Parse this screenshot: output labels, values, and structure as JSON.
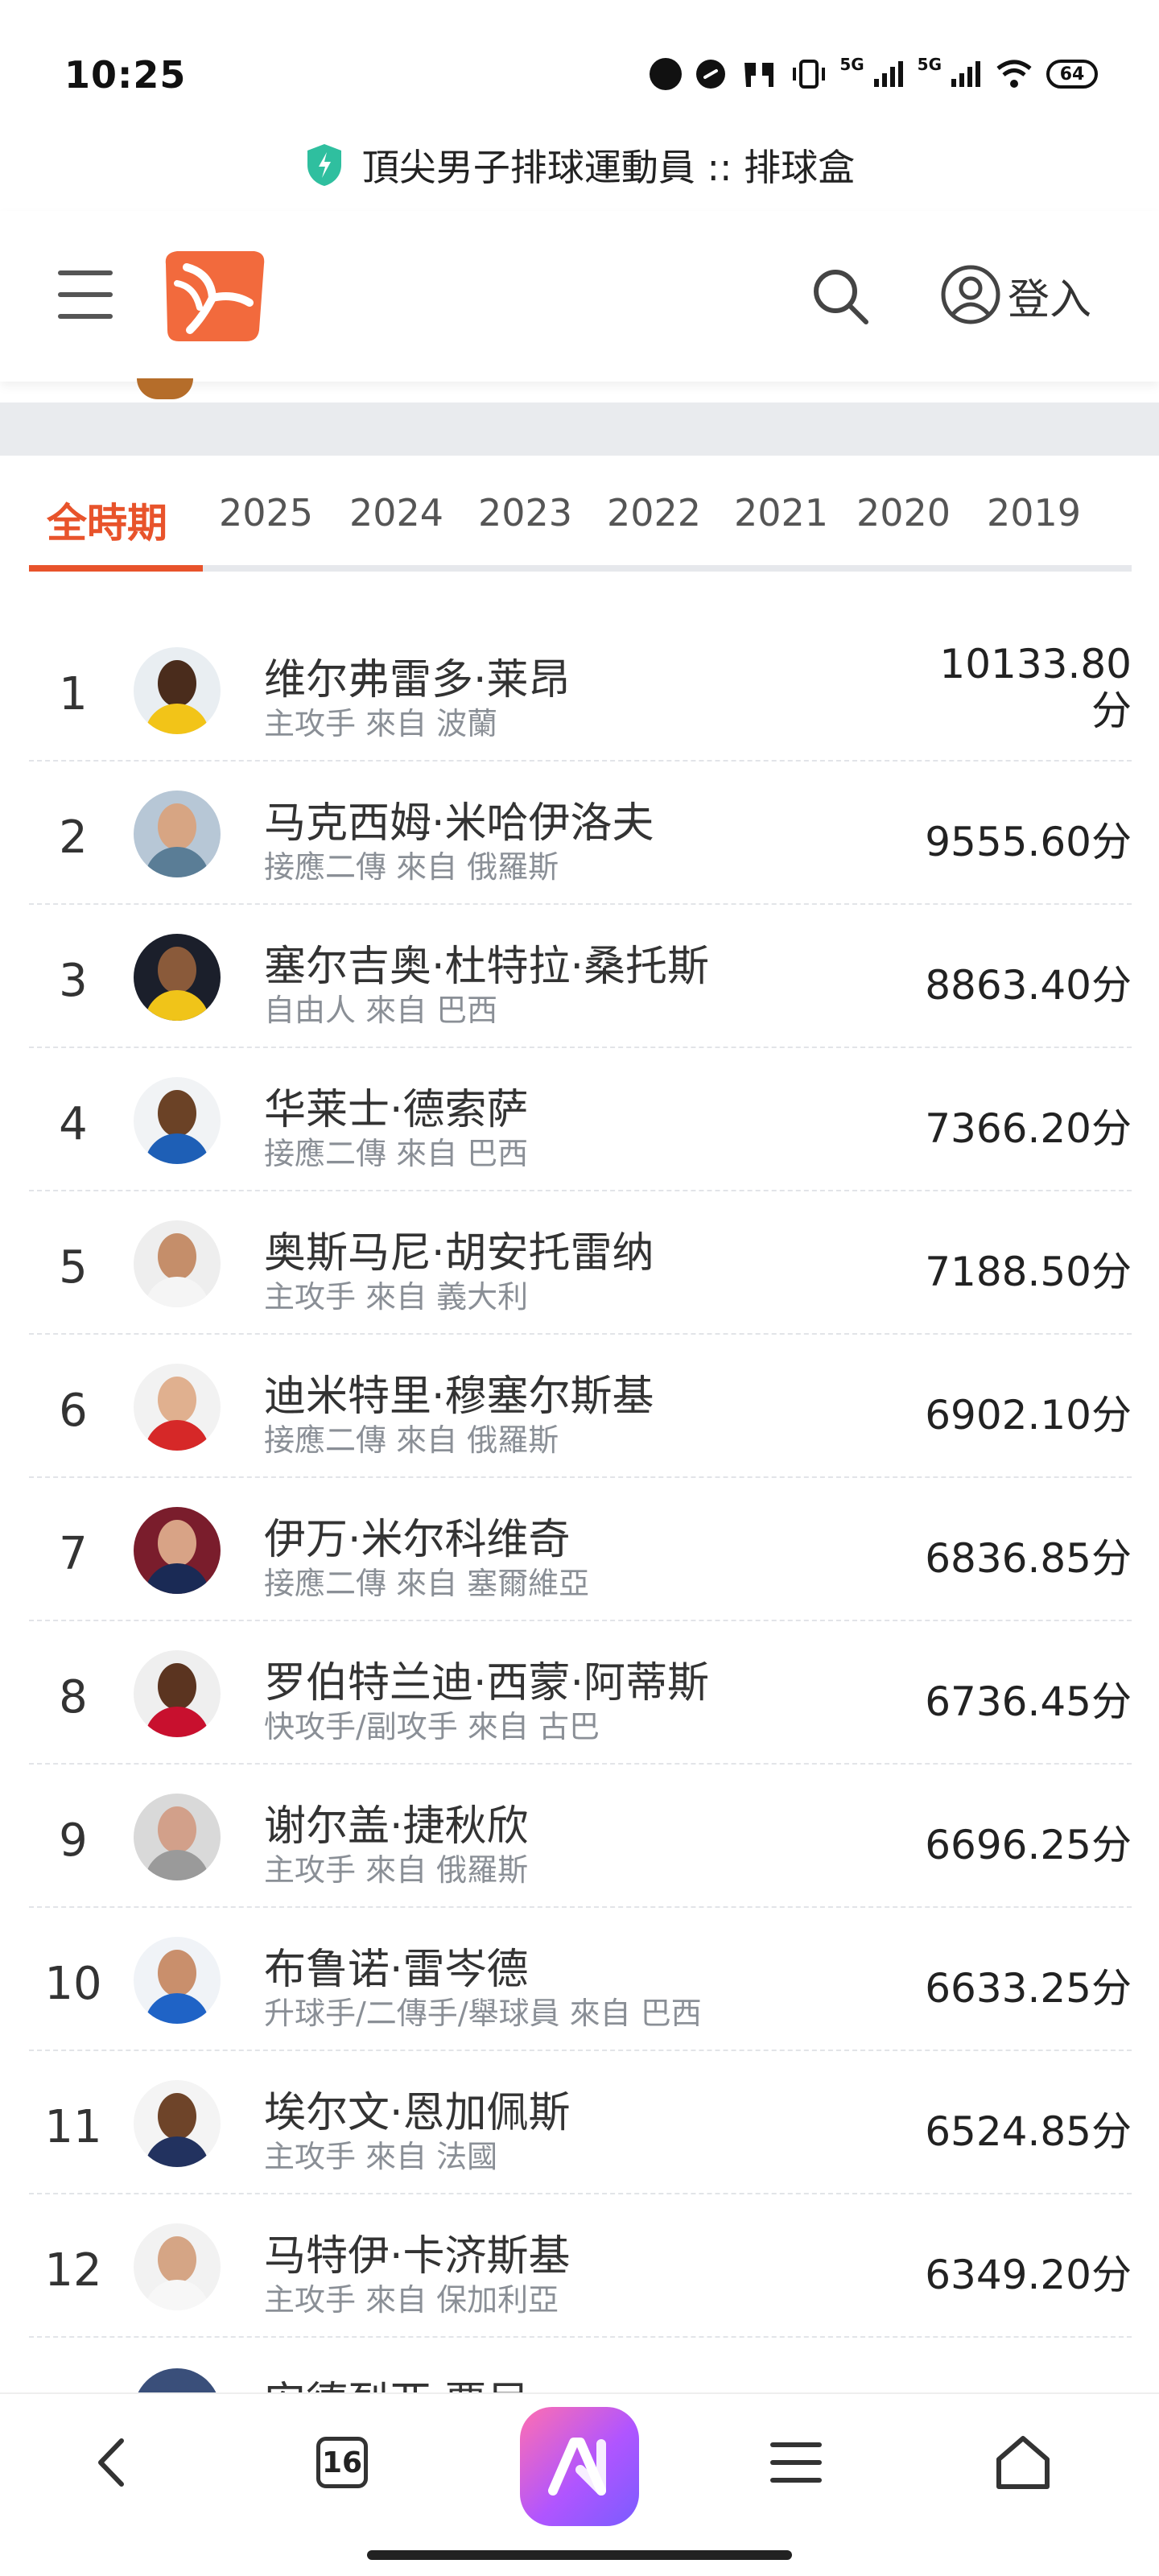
{
  "status_bar": {
    "time": "10:25",
    "network_1": "5G",
    "network_2": "5G",
    "battery": "64"
  },
  "page_title": "頂尖男子排球運動員 :: 排球盒",
  "header": {
    "login_label": "登入"
  },
  "tabs": [
    {
      "label": "全時期",
      "active": true
    },
    {
      "label": "2025"
    },
    {
      "label": "2024"
    },
    {
      "label": "2023"
    },
    {
      "label": "2022"
    },
    {
      "label": "2021"
    },
    {
      "label": "2020"
    },
    {
      "label": "2019"
    }
  ],
  "players": [
    {
      "rank": "1",
      "name": "维尔弗雷多·莱昂",
      "meta": "主攻手 來自 波蘭",
      "points_line1": "10133.80",
      "points_line2": "分",
      "avatar_bg": "#e9eef2",
      "skin": "#4a2c1c",
      "shirt": "#f2c418"
    },
    {
      "rank": "2",
      "name": "马克西姆·米哈伊洛夫",
      "meta": "接應二傳 來自 俄羅斯",
      "points": "9555.60分",
      "avatar_bg": "#b7c7d6",
      "skin": "#d7a583",
      "shirt": "#5a7d96"
    },
    {
      "rank": "3",
      "name": "塞尔吉奥·杜特拉·桑托斯",
      "meta": "自由人 來自 巴西",
      "points": "8863.40分",
      "avatar_bg": "#1b1f2b",
      "skin": "#8a5a3a",
      "shirt": "#f0c419"
    },
    {
      "rank": "4",
      "name": "华莱士·德索萨",
      "meta": "接應二傳 來自 巴西",
      "points": "7366.20分",
      "avatar_bg": "#f1f3f5",
      "skin": "#6b4226",
      "shirt": "#1e5fb6"
    },
    {
      "rank": "5",
      "name": "奥斯马尼·胡安托雷纳",
      "meta": "主攻手 來自 義大利",
      "points": "7188.50分",
      "avatar_bg": "#eeeeee",
      "skin": "#c58e6a",
      "shirt": "#f5f5f5"
    },
    {
      "rank": "6",
      "name": "迪米特里·穆塞尔斯基",
      "meta": "接應二傳 來自 俄羅斯",
      "points": "6902.10分",
      "avatar_bg": "#f2f2f2",
      "skin": "#e0b08f",
      "shirt": "#d62828"
    },
    {
      "rank": "7",
      "name": "伊万·米尔科维奇",
      "meta": "接應二傳 來自 塞爾維亞",
      "points": "6836.85分",
      "avatar_bg": "#7a1d2c",
      "skin": "#d8a386",
      "shirt": "#1a2a55"
    },
    {
      "rank": "8",
      "name": "罗伯特兰迪·西蒙·阿蒂斯",
      "meta": "快攻手/副攻手 來自 古巴",
      "points": "6736.45分",
      "avatar_bg": "#efefef",
      "skin": "#5b3420",
      "shirt": "#c8102e"
    },
    {
      "rank": "9",
      "name": "谢尔盖·捷秋欣",
      "meta": "主攻手 來自 俄羅斯",
      "points": "6696.25分",
      "avatar_bg": "#d9d9d9",
      "skin": "#d2a08a",
      "shirt": "#9a9a9a"
    },
    {
      "rank": "10",
      "name": "布鲁诺·雷岑德",
      "meta": "升球手/二傳手/舉球員 來自 巴西",
      "points": "6633.25分",
      "avatar_bg": "#f0f3f7",
      "skin": "#c98f6c",
      "shirt": "#1f63c6"
    },
    {
      "rank": "11",
      "name": "埃尔文·恩加佩斯",
      "meta": "主攻手 來自 法國",
      "points": "6524.85分",
      "avatar_bg": "#f4f4f4",
      "skin": "#6e4429",
      "shirt": "#22325f"
    },
    {
      "rank": "12",
      "name": "马特伊·卡济斯基",
      "meta": "主攻手 來自 保加利亞",
      "points": "6349.20分",
      "avatar_bg": "#f2f2f2",
      "skin": "#d5a585",
      "shirt": "#f7f7f7"
    }
  ],
  "partial_player": {
    "name": "安德烈亚·贾尼"
  },
  "bottom_bar": {
    "tab_count": "16"
  },
  "colors": {
    "accent": "#e8532b",
    "shield": "#2fbf9f"
  }
}
